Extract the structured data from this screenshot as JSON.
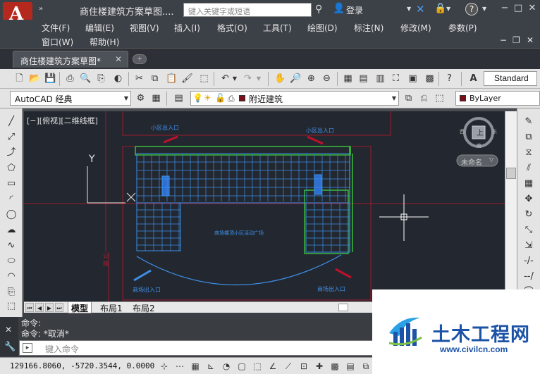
{
  "window": {
    "title": "商住楼建筑方案草图....",
    "app_logo_letter": "A",
    "search_placeholder": "键入关键字或短语",
    "login_label": "登录",
    "minimize": "−",
    "restore": "□",
    "close": "✕"
  },
  "menu": {
    "row1": [
      "文件(F)",
      "编辑(E)",
      "视图(V)",
      "插入(I)",
      "格式(O)",
      "工具(T)",
      "绘图(D)",
      "标注(N)",
      "修改(M)",
      "参数(P)"
    ],
    "row2": [
      "窗口(W)",
      "帮助(H)"
    ]
  },
  "doc_tab": {
    "label": "商住楼建筑方案草图*",
    "close": "✕"
  },
  "toolbar": {
    "text_style": "Standard",
    "workspace": "AutoCAD 经典",
    "layer": "附近建筑",
    "color": "ByLayer"
  },
  "viewport": {
    "label": "[−][俯视][二维线框]",
    "axis_y": "Y",
    "view_cube_top": "上",
    "view_cube_west": "西",
    "view_cube_east": "东",
    "view_cube_south": "南",
    "ucs_name": "未命名"
  },
  "drawing": {
    "entrance_tl": "小区出入口",
    "entrance_tr": "小区出入口",
    "plaza_label": "商场楼顶小区活动广场",
    "mall_entrance_l": "商场出入口",
    "mall_entrance_r": "商场出入口",
    "red_label": "公路"
  },
  "layout_tabs": [
    "模型",
    "布局1",
    "布局2"
  ],
  "command": {
    "line1": "命令:",
    "line2": "命令: *取消*",
    "placeholder": "键入命令"
  },
  "status": {
    "coords": "129166.8060, -5720.3544, 0.0000"
  },
  "watermark": {
    "text": "土木工程网",
    "url": "www.civilcn.com"
  },
  "colors": {
    "canvas_bg": "#232830",
    "building_blue": "#3e8fe8",
    "building_green": "#3ee03e",
    "boundary_red": "#b01830",
    "brand_blue": "#1c53a6"
  }
}
